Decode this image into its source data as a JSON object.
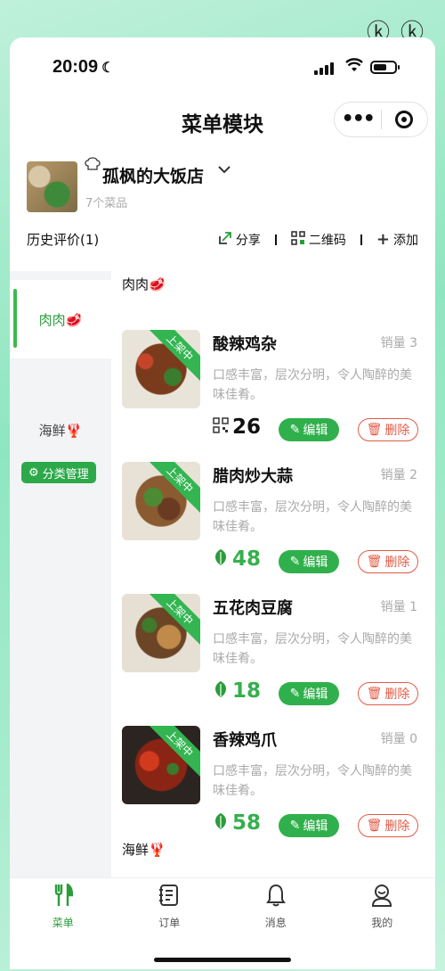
{
  "status_bar": {
    "time": "20:09",
    "moon_icon": "☾"
  },
  "nav": {
    "title": "菜单模块",
    "more_icon": "•••"
  },
  "shop": {
    "name": "孤枫的大饭店",
    "dish_count": "7个菜品"
  },
  "actions": {
    "history": "历史评价(1)",
    "share": "分享",
    "qrcode": "二维码",
    "add": "添加"
  },
  "sidebar": {
    "items": [
      {
        "label": "肉肉🥩",
        "active": true
      },
      {
        "label": "海鲜🦞",
        "active": false
      }
    ],
    "category_manage": "分类管理"
  },
  "sections": [
    {
      "title": "肉肉🥩",
      "dishes": [
        {
          "name": "酸辣鸡杂",
          "sales": "销量 3",
          "desc": "口感丰富，层次分明，令人陶醉的美味佳肴。",
          "price": "26",
          "price_icon": "qr-icon",
          "badge": "上架中",
          "edit": "编辑",
          "delete": "删除"
        },
        {
          "name": "腊肉炒大蒜",
          "sales": "销量 2",
          "desc": "口感丰富，层次分明，令人陶醉的美味佳肴。",
          "price": "48",
          "price_icon": "leaf-icon",
          "badge": "上架中",
          "edit": "编辑",
          "delete": "删除"
        },
        {
          "name": "五花肉豆腐",
          "sales": "销量 1",
          "desc": "口感丰富，层次分明，令人陶醉的美味佳肴。",
          "price": "18",
          "price_icon": "leaf-icon",
          "badge": "上架中",
          "edit": "编辑",
          "delete": "删除"
        },
        {
          "name": "香辣鸡爪",
          "sales": "销量 0",
          "desc": "口感丰富，层次分明，令人陶醉的美味佳肴。",
          "price": "58",
          "price_icon": "leaf-icon",
          "badge": "上架中",
          "edit": "编辑",
          "delete": "删除"
        }
      ]
    },
    {
      "title": "海鲜🦞"
    }
  ],
  "tabbar": {
    "items": [
      {
        "label": "菜单",
        "active": true
      },
      {
        "label": "订单",
        "active": false
      },
      {
        "label": "消息",
        "active": false
      },
      {
        "label": "我的",
        "active": false
      }
    ]
  },
  "colors": {
    "accent": "#2a9d3a",
    "danger": "#e25a46",
    "price_green": "#35b04c"
  }
}
